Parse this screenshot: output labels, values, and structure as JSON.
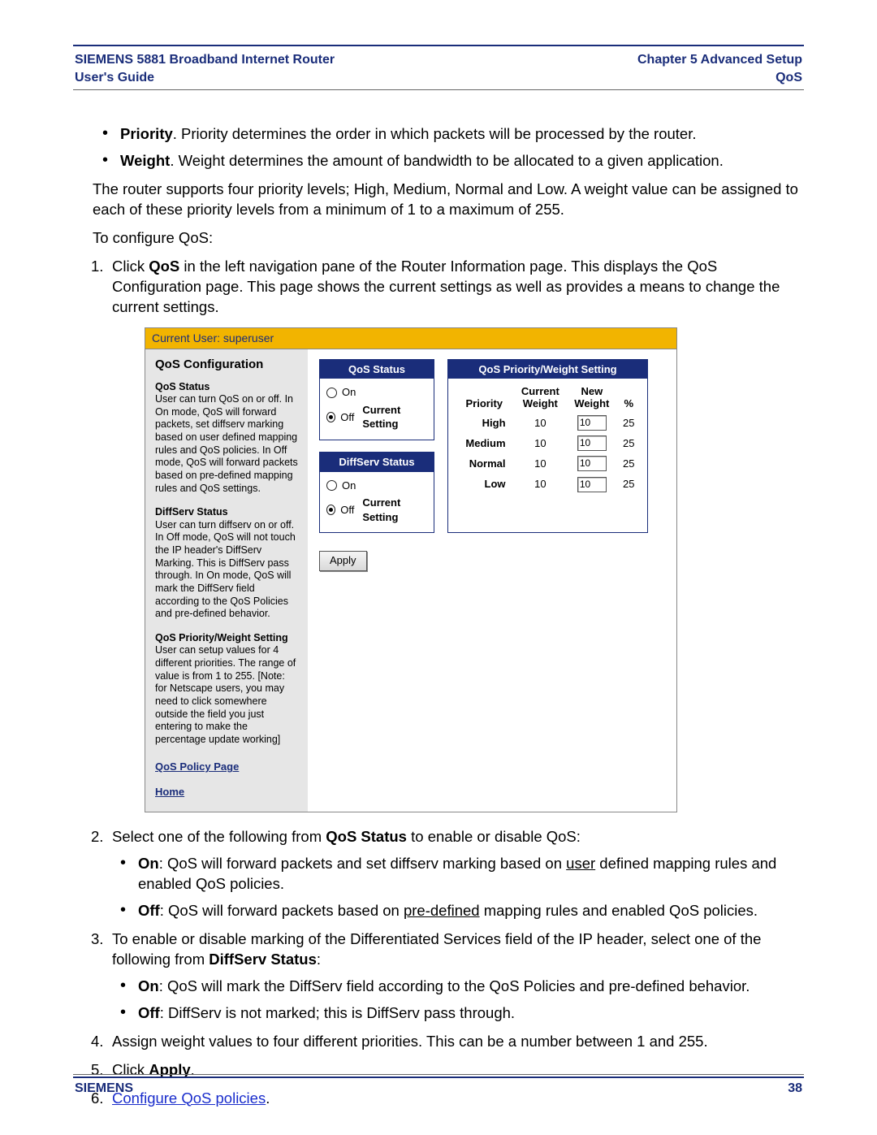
{
  "header": {
    "product_line1": "SIEMENS 5881 Broadband Internet Router",
    "product_line2": "User's Guide",
    "chapter": "Chapter 5  Advanced Setup",
    "section": "QoS"
  },
  "intro": {
    "bullet_priority_bold": "Priority",
    "bullet_priority_rest": ". Priority determines the order in which packets will be processed by the router.",
    "bullet_weight_bold": "Weight",
    "bullet_weight_rest": ". Weight determines the amount of bandwidth to be allocated to a given application.",
    "para_levels": "The router supports four priority levels; High, Medium, Normal and Low. A weight value can be assigned to each of these priority levels from a minimum of 1 to a maximum of 255.",
    "para_toconfig": "To configure QoS:"
  },
  "steps": {
    "s1_a": "Click ",
    "s1_b": "QoS",
    "s1_c": " in the left navigation pane of the Router Information page. This displays the QoS Configuration page. This page shows the current settings as well as provides a means to change the current settings.",
    "s2_a": "Select one of the following from ",
    "s2_b": "QoS Status",
    "s2_c": " to enable or disable QoS:",
    "s2_on_b": "On",
    "s2_on_1": ": QoS will forward packets and set diffserv marking based on ",
    "s2_on_u": "user",
    "s2_on_2": " defined mapping rules and enabled QoS policies.",
    "s2_off_b": "Off",
    "s2_off_1": ": QoS will forward packets based on ",
    "s2_off_u": "pre-defined",
    "s2_off_2": " mapping rules and enabled QoS policies.",
    "s3_a": "To enable or disable marking of the Differentiated Services field of the IP header, select one of the following from ",
    "s3_b": "DiffServ Status",
    "s3_c": ":",
    "s3_on_b": "On",
    "s3_on_t": ": QoS will mark the DiffServ field according to the QoS Policies and pre-defined behavior.",
    "s3_off_b": "Off",
    "s3_off_t": ": DiffServ is not marked; this is DiffServ pass through.",
    "s4": "Assign weight values to four different priorities. This can be a number between 1 and 255.",
    "s5_a": "Click ",
    "s5_b": "Apply",
    "s5_c": ".",
    "s6_link": "Configure QoS policies",
    "s6_dot": "."
  },
  "panel": {
    "current_user": "Current User: superuser",
    "title": "QoS Configuration",
    "side": {
      "h1": "QoS Status",
      "t1": "User can turn QoS on or off. In On mode, QoS will forward packets, set diffserv marking based on user defined mapping rules and QoS policies. In Off mode, QoS will forward packets based on pre-defined mapping rules and QoS settings.",
      "h2": "DiffServ Status",
      "t2": "User can turn diffserv on or off. In Off mode, QoS will not touch the IP header's DiffServ Marking. This is DiffServ pass through. In On mode, QoS will mark the DiffServ field according to the QoS Policies and pre-defined behavior.",
      "h3": "QoS Priority/Weight Setting",
      "t3": "User can setup values for 4 different priorities. The range of value is from 1 to 255. [Note: for Netscape users, you may need to click somewhere outside the field you just entering to make the percentage update working]",
      "link1": "QoS Policy Page",
      "link2": "Home"
    },
    "qos_status": {
      "head": "QoS Status",
      "on": "On",
      "off": "Off",
      "current": "Current Setting",
      "selected": "off"
    },
    "diffserv_status": {
      "head": "DiffServ Status",
      "on": "On",
      "off": "Off",
      "current": "Current Setting",
      "selected": "off"
    },
    "pw": {
      "head": "QoS Priority/Weight Setting",
      "col_priority": "Priority",
      "col_current": "Current\nWeight",
      "col_new": "New\nWeight",
      "col_pct": "%",
      "rows": [
        {
          "label": "High",
          "current": "10",
          "new": "10",
          "pct": "25"
        },
        {
          "label": "Medium",
          "current": "10",
          "new": "10",
          "pct": "25"
        },
        {
          "label": "Normal",
          "current": "10",
          "new": "10",
          "pct": "25"
        },
        {
          "label": "Low",
          "current": "10",
          "new": "10",
          "pct": "25"
        }
      ]
    },
    "apply": "Apply"
  },
  "footer": {
    "brand": "SIEMENS",
    "page": "38"
  }
}
